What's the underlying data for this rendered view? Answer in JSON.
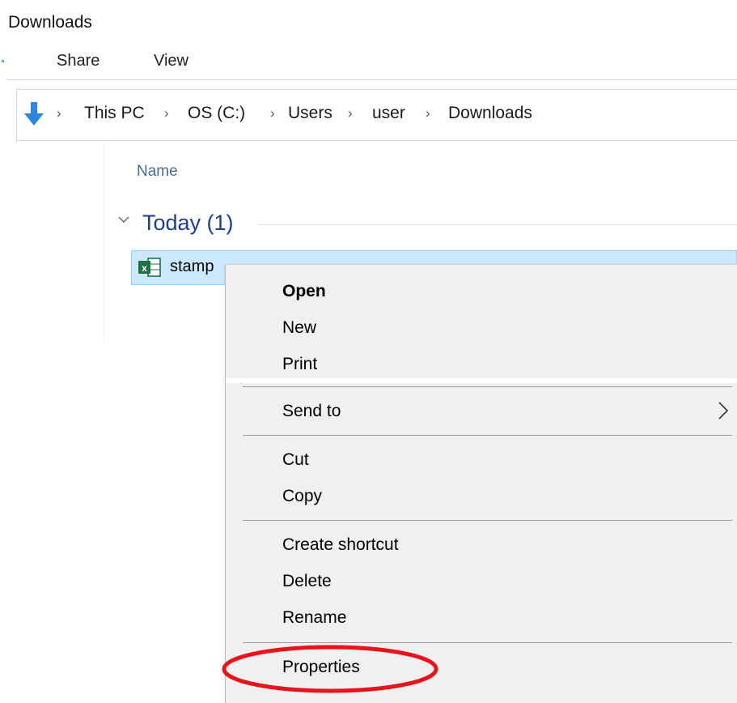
{
  "window": {
    "title": "Downloads"
  },
  "ribbon": {
    "tabs": [
      "Share",
      "View"
    ]
  },
  "address_bar": {
    "crumbs": [
      "This PC",
      "OS (C:)",
      "Users",
      "user",
      "Downloads"
    ],
    "separator": "›"
  },
  "file_list": {
    "column_header": "Name",
    "group": {
      "title": "Today (1)"
    },
    "files": [
      {
        "name": "stamp",
        "type": "excel-file"
      }
    ]
  },
  "context_menu": {
    "items": [
      "Open",
      "New",
      "Print",
      "Send to",
      "Cut",
      "Copy",
      "Create shortcut",
      "Delete",
      "Rename",
      "Properties"
    ],
    "default_item": "Open",
    "submenu_item": "Send to",
    "highlighted_item": "Properties"
  },
  "colors": {
    "selection_bg": "#cce8ff",
    "selection_border": "#99d1ff",
    "menu_bg": "#f0f0f0",
    "highlight_ellipse": "#e8141b",
    "excel_green": "#1e7145",
    "nav_arrow_blue": "#2e86de",
    "group_title": "#1e3d8c"
  },
  "icons": {
    "address_bar": "down-arrow-icon",
    "group_toggle": "chevron-down-icon",
    "file": "excel-file-icon",
    "submenu": "chevron-right-icon"
  }
}
